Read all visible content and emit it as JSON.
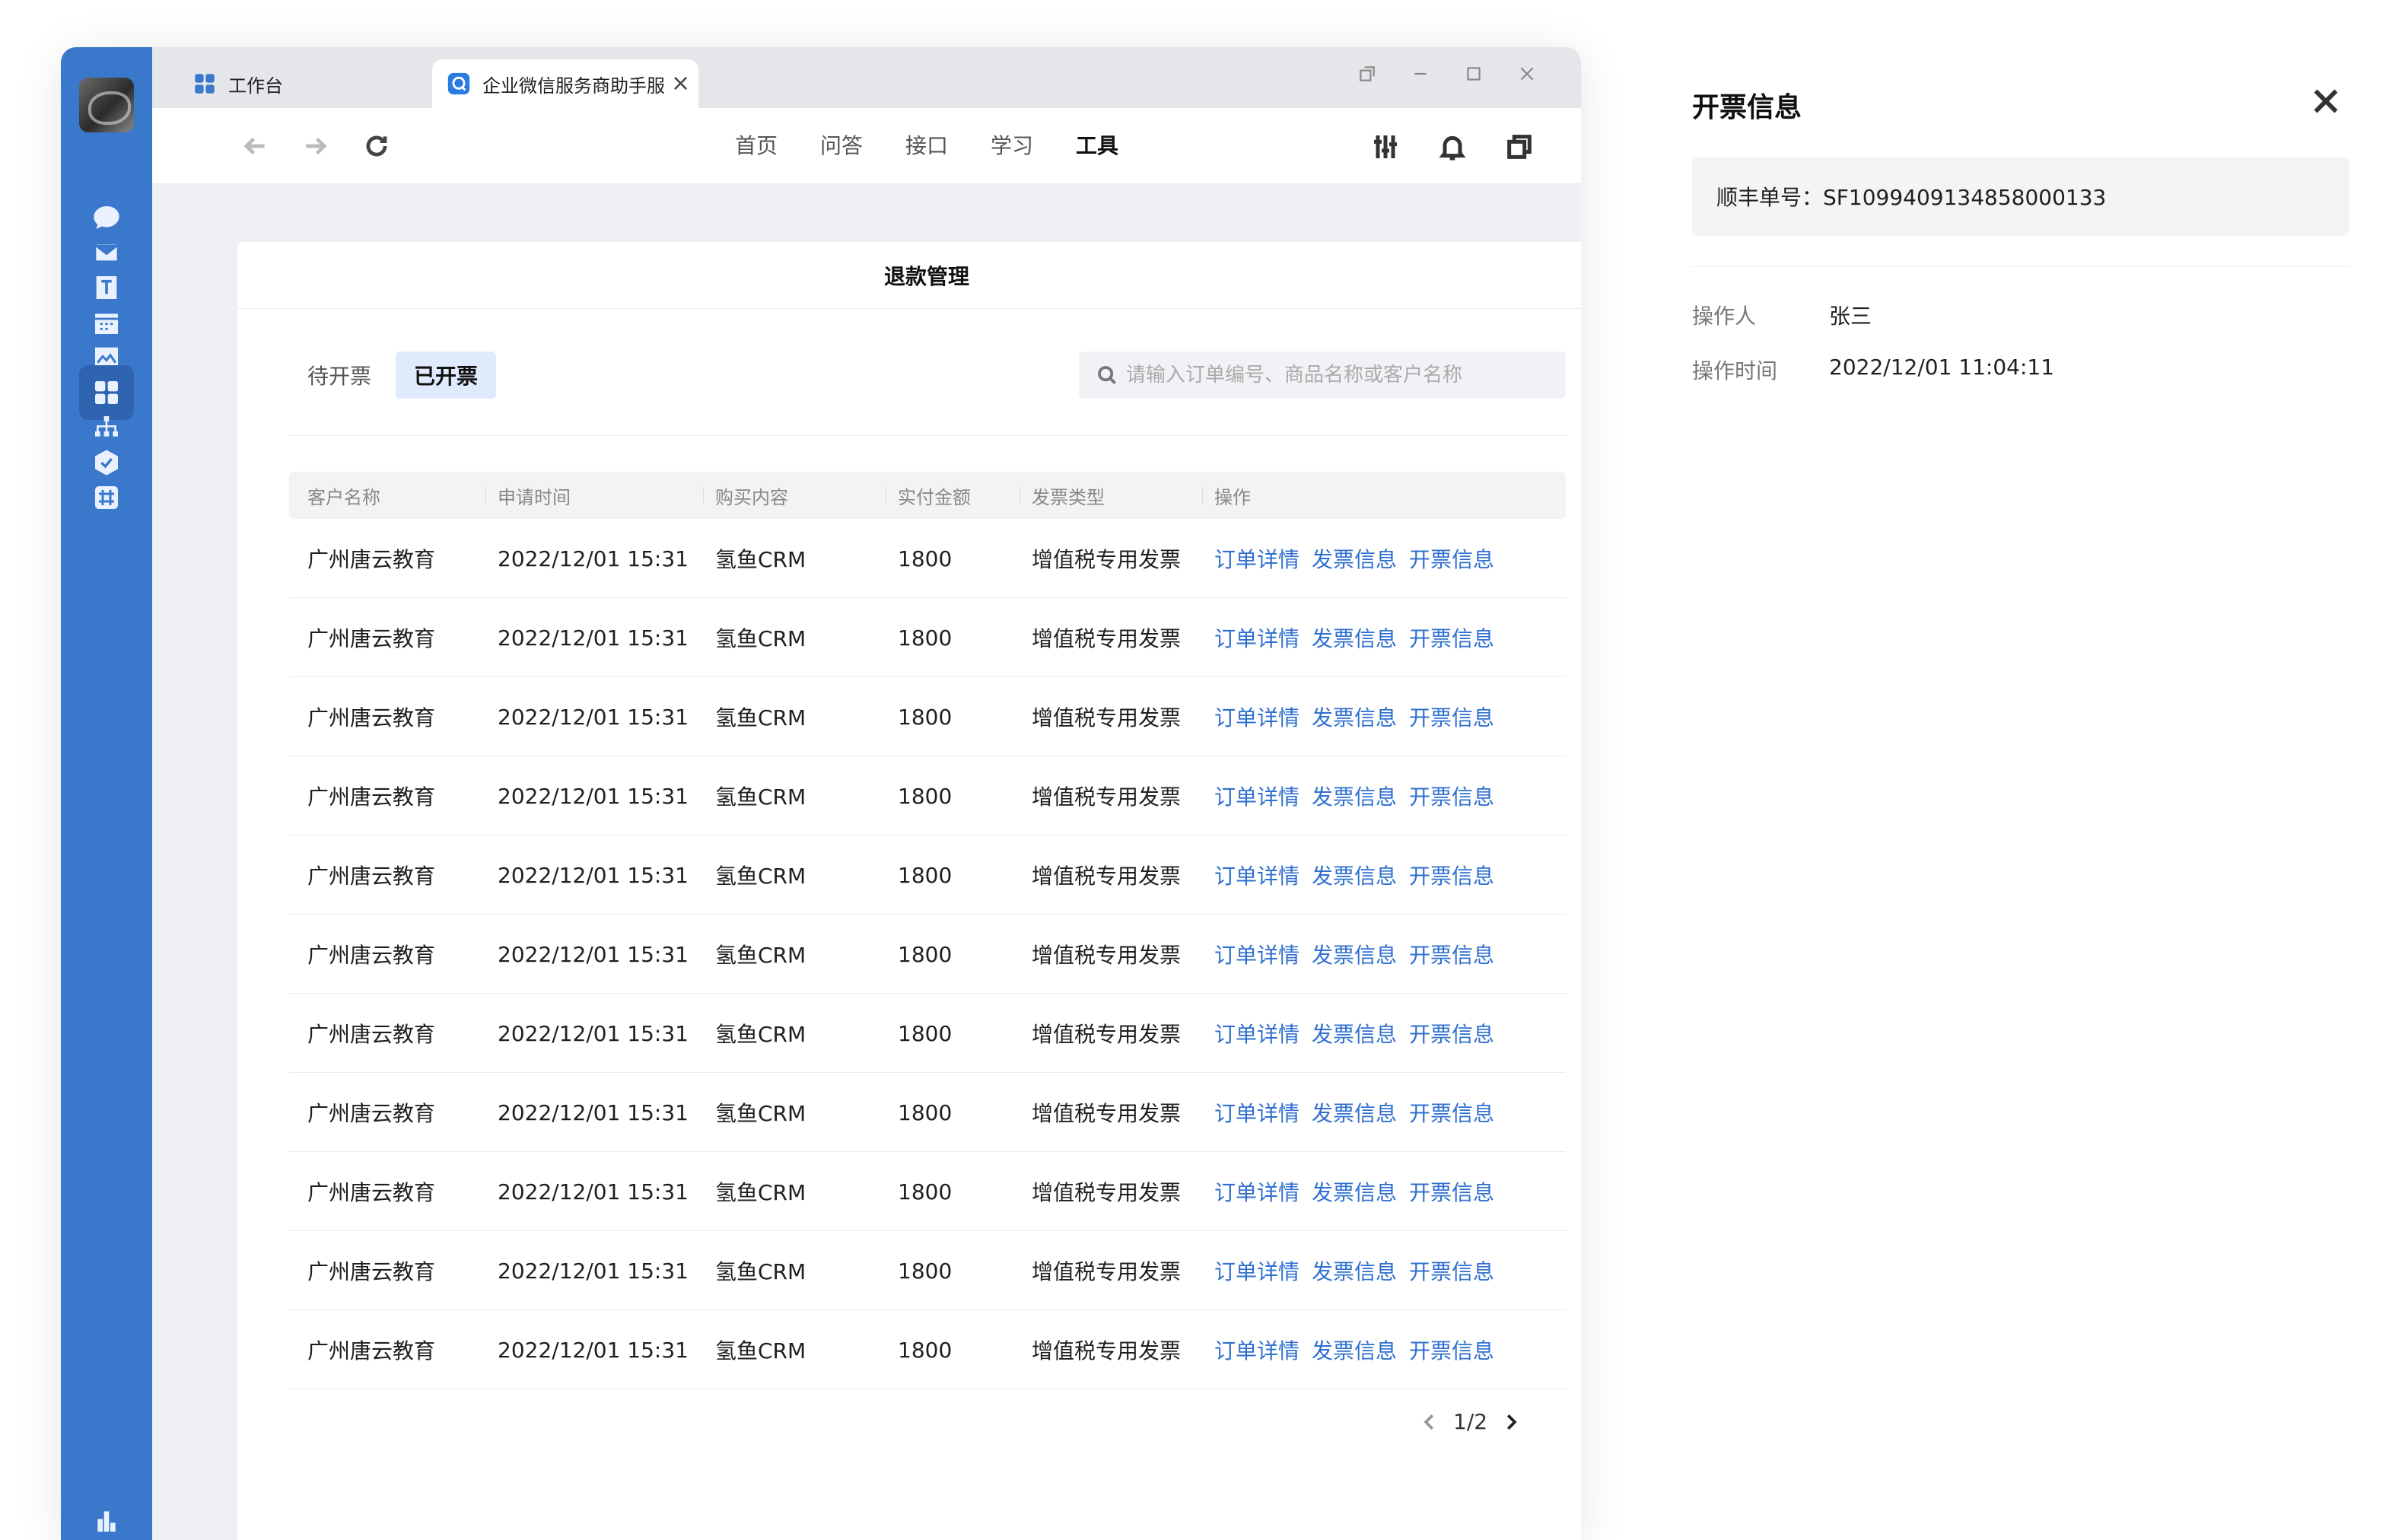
{
  "window": {
    "tabs": [
      {
        "label": "工作台",
        "active": false
      },
      {
        "label": "企业微信服务商助手服务",
        "active": true
      }
    ]
  },
  "top_nav": [
    "首页",
    "问答",
    "接口",
    "学习",
    "工具"
  ],
  "page": {
    "title": "退款管理",
    "segments": [
      "待开票",
      "已开票"
    ],
    "search_placeholder": "请输入订单编号、商品名称或客户名称"
  },
  "table": {
    "columns": [
      "客户名称",
      "申请时间",
      "购买内容",
      "实付金额",
      "发票类型",
      "操作"
    ],
    "actions": [
      "订单详情",
      "发票信息",
      "开票信息"
    ],
    "rows": [
      {
        "customer": "广州唐云教育",
        "time": "2022/12/01 15:31",
        "product": "氢鱼CRM",
        "amount": "1800",
        "invoice_type": "增值税专用发票"
      },
      {
        "customer": "广州唐云教育",
        "time": "2022/12/01 15:31",
        "product": "氢鱼CRM",
        "amount": "1800",
        "invoice_type": "增值税专用发票"
      },
      {
        "customer": "广州唐云教育",
        "time": "2022/12/01 15:31",
        "product": "氢鱼CRM",
        "amount": "1800",
        "invoice_type": "增值税专用发票"
      },
      {
        "customer": "广州唐云教育",
        "time": "2022/12/01 15:31",
        "product": "氢鱼CRM",
        "amount": "1800",
        "invoice_type": "增值税专用发票"
      },
      {
        "customer": "广州唐云教育",
        "time": "2022/12/01 15:31",
        "product": "氢鱼CRM",
        "amount": "1800",
        "invoice_type": "增值税专用发票"
      },
      {
        "customer": "广州唐云教育",
        "time": "2022/12/01 15:31",
        "product": "氢鱼CRM",
        "amount": "1800",
        "invoice_type": "增值税专用发票"
      },
      {
        "customer": "广州唐云教育",
        "time": "2022/12/01 15:31",
        "product": "氢鱼CRM",
        "amount": "1800",
        "invoice_type": "增值税专用发票"
      },
      {
        "customer": "广州唐云教育",
        "time": "2022/12/01 15:31",
        "product": "氢鱼CRM",
        "amount": "1800",
        "invoice_type": "增值税专用发票"
      },
      {
        "customer": "广州唐云教育",
        "time": "2022/12/01 15:31",
        "product": "氢鱼CRM",
        "amount": "1800",
        "invoice_type": "增值税专用发票"
      },
      {
        "customer": "广州唐云教育",
        "time": "2022/12/01 15:31",
        "product": "氢鱼CRM",
        "amount": "1800",
        "invoice_type": "增值税专用发票"
      },
      {
        "customer": "广州唐云教育",
        "time": "2022/12/01 15:31",
        "product": "氢鱼CRM",
        "amount": "1800",
        "invoice_type": "增值税专用发票"
      }
    ]
  },
  "pagination": {
    "text": "1/2"
  },
  "panel": {
    "title": "开票信息",
    "tracking": "顺丰单号：SF1099409134858000133",
    "operator_label": "操作人",
    "operator_value": "张三",
    "time_label": "操作时间",
    "time_value": "2022/12/01 11:04:11"
  },
  "colors": {
    "sidebar": "#3a78cc",
    "link": "#2f6fd0",
    "segment_active_bg": "#dfeafc"
  }
}
